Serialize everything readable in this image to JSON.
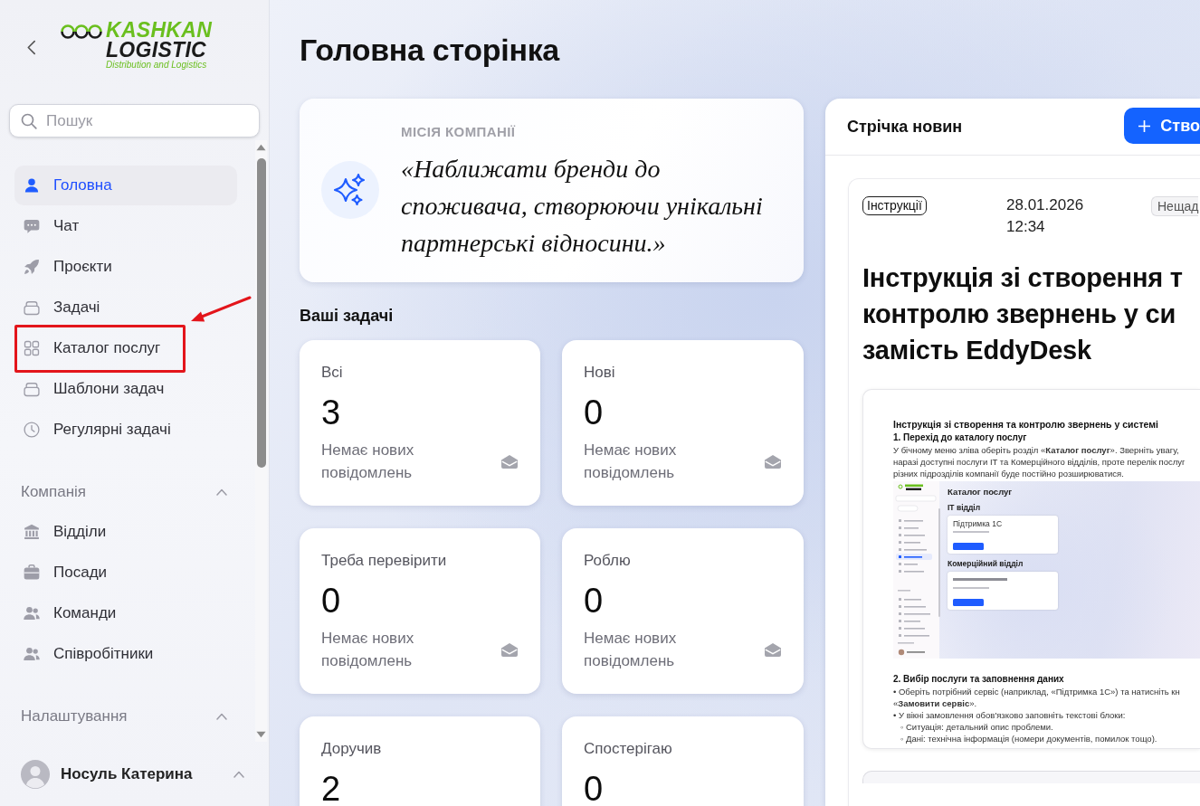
{
  "sidebar": {
    "logo": {
      "title": "KASHKAN",
      "subtitle": "LOGISTIC",
      "tagline": "Distribution and Logistics"
    },
    "search": {
      "placeholder": "Пошук"
    },
    "nav": [
      {
        "label": "Головна",
        "selected": true,
        "highlighted": false
      },
      {
        "label": "Чат",
        "selected": false,
        "highlighted": false
      },
      {
        "label": "Проєкти",
        "selected": false,
        "highlighted": false
      },
      {
        "label": "Задачі",
        "selected": false,
        "highlighted": false
      },
      {
        "label": "Каталог послуг",
        "selected": false,
        "highlighted": true
      },
      {
        "label": "Шаблони задач",
        "selected": false,
        "highlighted": false
      },
      {
        "label": "Регулярні задачі",
        "selected": false,
        "highlighted": false
      }
    ],
    "sections": [
      {
        "title": "Компанія",
        "expanded": true,
        "items": [
          {
            "label": "Відділи",
            "selected": false,
            "highlighted": false
          },
          {
            "label": "Посади",
            "selected": false,
            "highlighted": false
          },
          {
            "label": "Команди",
            "selected": false,
            "highlighted": false
          },
          {
            "label": "Співробітники",
            "selected": false,
            "highlighted": false
          }
        ]
      },
      {
        "title": "Налаштування",
        "expanded": true
      }
    ],
    "user": {
      "name": "Носуль Катерина"
    }
  },
  "page_title": "Головна сторінка",
  "mission": {
    "label": "МІСІЯ КОМПАНІЇ",
    "quote": "«Наближати бренди до споживача, створюючи унікальні партнерські відносини.»"
  },
  "tasks": {
    "title": "Ваші задачі",
    "cards": [
      {
        "label": "Всі",
        "count": "3",
        "note": "Немає нових повідомлень"
      },
      {
        "label": "Нові",
        "count": "0",
        "note": "Немає нових повідомлень"
      },
      {
        "label": "Треба перевірити",
        "count": "0",
        "note": "Немає нових повідомлень"
      },
      {
        "label": "Роблю",
        "count": "0",
        "note": "Немає нових повідомлень"
      },
      {
        "label": "Доручив",
        "count": "2"
      },
      {
        "label": "Спостерігаю",
        "count": "0"
      }
    ]
  },
  "news": {
    "title": "Стрічка новин",
    "create_button": "Ство",
    "posts": [
      {
        "tag": "Інструкції",
        "date": "28.01.2026",
        "time": "12:34",
        "badge": "Нещад",
        "headline_lines": [
          "Інструкція зі створення т",
          "контролю звернень у си",
          "замість EddyDesk"
        ],
        "document": {
          "title": "Інструкція зі створення та контролю звернень у системі",
          "blocks": [
            {
              "kind": "heading",
              "text": "1. Перехід до каталогу послуг"
            },
            {
              "kind": "paragraph",
              "lines": [
                "У бічному меню зліва оберіть розділ «**Каталог послуг**». Зверніть увагу,",
                "наразі доступні послуги IT та Комерційного відділів, проте перелік послуг",
                "різних підрозділів компанії буде постійно розширюватися."
              ]
            },
            {
              "kind": "screenshot",
              "title": "Каталог послуг",
              "sections": [
                {
                  "title": "IT відділ",
                  "cards": [
                    {
                      "kind": "service",
                      "title": "Підтримка 1С"
                    }
                  ]
                },
                {
                  "title": "Комерційний відділ",
                  "cards": [
                    {
                      "kind": "service"
                    }
                  ]
                }
              ]
            },
            {
              "kind": "heading",
              "text": "2. Вибір послуги та заповнення даних"
            },
            {
              "kind": "bullet",
              "lines": [
                "• Оберіть потрібний сервіс (наприклад, «Підтримка 1С») та натисніть кн",
                "«**Замовити сервіс**»."
              ]
            },
            {
              "kind": "bullet",
              "lines": [
                "• У вікні замовлення обов'язково заповніть текстові блоки:"
              ]
            },
            {
              "kind": "sub_bullet",
              "lines": [
                "◦ Ситуація: детальний опис проблеми."
              ]
            },
            {
              "kind": "sub_bullet",
              "lines": [
                "◦ Дані: технічна інформація (номери документів, помилок тощо)."
              ]
            }
          ]
        }
      }
    ]
  }
}
